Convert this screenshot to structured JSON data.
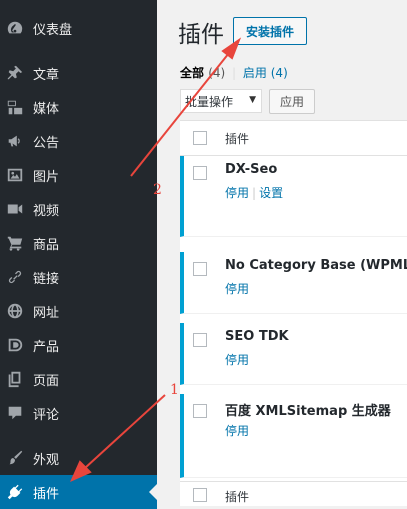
{
  "sidebar": {
    "items": [
      {
        "label": "仪表盘",
        "icon": "dashboard-icon"
      },
      {
        "label": "文章",
        "icon": "pin-icon"
      },
      {
        "label": "媒体",
        "icon": "media-icon"
      },
      {
        "label": "公告",
        "icon": "megaphone-icon"
      },
      {
        "label": "图片",
        "icon": "image-icon"
      },
      {
        "label": "视频",
        "icon": "video-icon"
      },
      {
        "label": "商品",
        "icon": "cart-icon"
      },
      {
        "label": "链接",
        "icon": "link-icon"
      },
      {
        "label": "网址",
        "icon": "globe-icon"
      },
      {
        "label": "产品",
        "icon": "product-icon"
      },
      {
        "label": "页面",
        "icon": "pages-icon"
      },
      {
        "label": "评论",
        "icon": "comment-icon"
      },
      {
        "label": "外观",
        "icon": "brush-icon"
      },
      {
        "label": "插件",
        "icon": "plugin-icon",
        "active": true
      }
    ]
  },
  "header": {
    "title": "插件",
    "add_button": "安装插件"
  },
  "filters": {
    "all_label": "全部",
    "all_count": "(4)",
    "separator": "|",
    "active_label": "启用",
    "active_count": "(4)"
  },
  "bulk": {
    "select_value": "批量操作",
    "apply_label": "应用"
  },
  "table": {
    "column_header": "插件",
    "footer_header": "插件",
    "plugins": [
      {
        "name": "DX-Seo",
        "actions": [
          "停用",
          "设置"
        ]
      },
      {
        "name": "No Category Base (WPML)",
        "actions": [
          "停用"
        ]
      },
      {
        "name": "SEO TDK",
        "actions": [
          "停用"
        ]
      },
      {
        "name": "百度 XMLSitemap 生成器",
        "actions": [
          "停用"
        ]
      }
    ]
  },
  "annotations": {
    "arrow_1_label": "1",
    "arrow_2_label": "2",
    "color": "#e8453c"
  },
  "colors": {
    "sidebar_bg": "#23282d",
    "active_bg": "#0073aa",
    "link": "#0073aa",
    "active_plugin_border": "#00a0d2"
  }
}
